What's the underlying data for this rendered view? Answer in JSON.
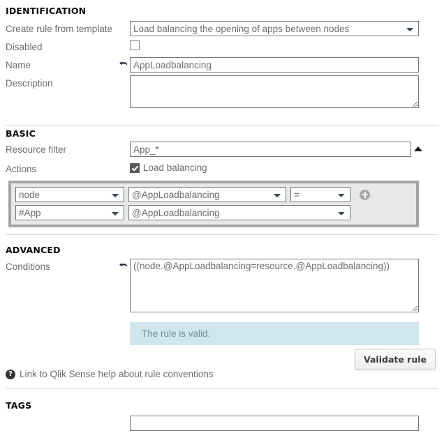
{
  "sections": {
    "identification": {
      "title": "IDENTIFICATION",
      "template": {
        "label": "Create rule from template",
        "value": "Load balancing the opening of apps between nodes"
      },
      "disabled": {
        "label": "Disabled",
        "checked": false
      },
      "name": {
        "label": "Name",
        "value": "AppLoadbalancing",
        "undo_icon": "undo-arrow-icon"
      },
      "description": {
        "label": "Description",
        "value": "",
        "placeholder": ""
      }
    },
    "basic": {
      "title": "BASIC",
      "resource_filter": {
        "label": "Resource filter",
        "value": "App_*",
        "toggle_icon": "triangle-up-icon"
      },
      "actions": {
        "label": "Actions",
        "checkbox_label": "Load balancing",
        "checked": true,
        "rows": [
          {
            "subject": "node",
            "attribute": "@AppLoadbalancing",
            "operator": "="
          },
          {
            "subject": "#App",
            "attribute": "@AppLoadbalancing",
            "operator": null
          }
        ],
        "add_icon": "plus-circle-icon"
      }
    },
    "advanced": {
      "title": "ADVANCED",
      "conditions": {
        "label": "Conditions",
        "value": "((node.@AppLoadbalancing=resource.@AppLoadbalancing))",
        "undo_icon": "undo-arrow-icon"
      },
      "validation": {
        "message": "The rule is valid.",
        "background": "#cfe6ef",
        "text_color": "#6d8a96"
      },
      "validate_button": "Validate rule",
      "help_link": {
        "icon": "question-circle-icon",
        "text": "Link to Qlik Sense help about rule conventions"
      }
    },
    "tags": {
      "title": "TAGS",
      "input": {
        "value": "",
        "placeholder": ""
      }
    }
  }
}
